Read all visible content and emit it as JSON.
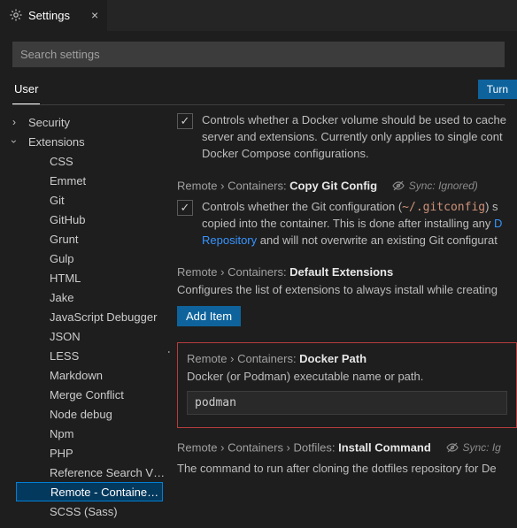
{
  "tab": {
    "title": "Settings"
  },
  "search": {
    "placeholder": "Search settings"
  },
  "scope": {
    "user": "User",
    "turn_button": "Turn"
  },
  "tree": {
    "security": "Security",
    "extensions": "Extensions",
    "items": {
      "css": "CSS",
      "emmet": "Emmet",
      "git": "Git",
      "github": "GitHub",
      "grunt": "Grunt",
      "gulp": "Gulp",
      "html": "HTML",
      "jake": "Jake",
      "jsdbg": "JavaScript Debugger",
      "json": "JSON",
      "less": "LESS",
      "markdown": "Markdown",
      "merge": "Merge Conflict",
      "nodedbg": "Node debug",
      "npm": "Npm",
      "php": "PHP",
      "refsearch": "Reference Search V…",
      "remote": "Remote - Containe…",
      "scss": "SCSS (Sass)"
    }
  },
  "settings": {
    "cache": {
      "desc": "Controls whether a Docker volume should be used to cache server and extensions. Currently only applies to single cont Docker Compose configurations."
    },
    "copygit": {
      "crumb": "Remote › Containers: ",
      "name": "Copy Git Config",
      "sync": "(",
      "sync_text": "Sync: Ignored)",
      "desc1": "Controls whether the Git configuration (",
      "code": "~/.gitconfig",
      "desc2": ") s copied into the container. This is done after installing any ",
      "link": "Repository",
      "desc3": " and will not overwrite an existing Git configurat"
    },
    "defext": {
      "crumb": "Remote › Containers: ",
      "name": "Default Extensions",
      "desc": "Configures the list of extensions to always install while creating",
      "add": "Add Item"
    },
    "dockerpath": {
      "crumb": "Remote › Containers: ",
      "name": "Docker Path",
      "desc": "Docker (or Podman) executable name or path.",
      "value": "podman"
    },
    "dotfiles": {
      "crumb": "Remote › Containers › Dotfiles: ",
      "name": "Install Command",
      "sync": "(",
      "sync_text": "Sync: Ig",
      "desc": "The command to run after cloning the dotfiles repository for De"
    }
  }
}
